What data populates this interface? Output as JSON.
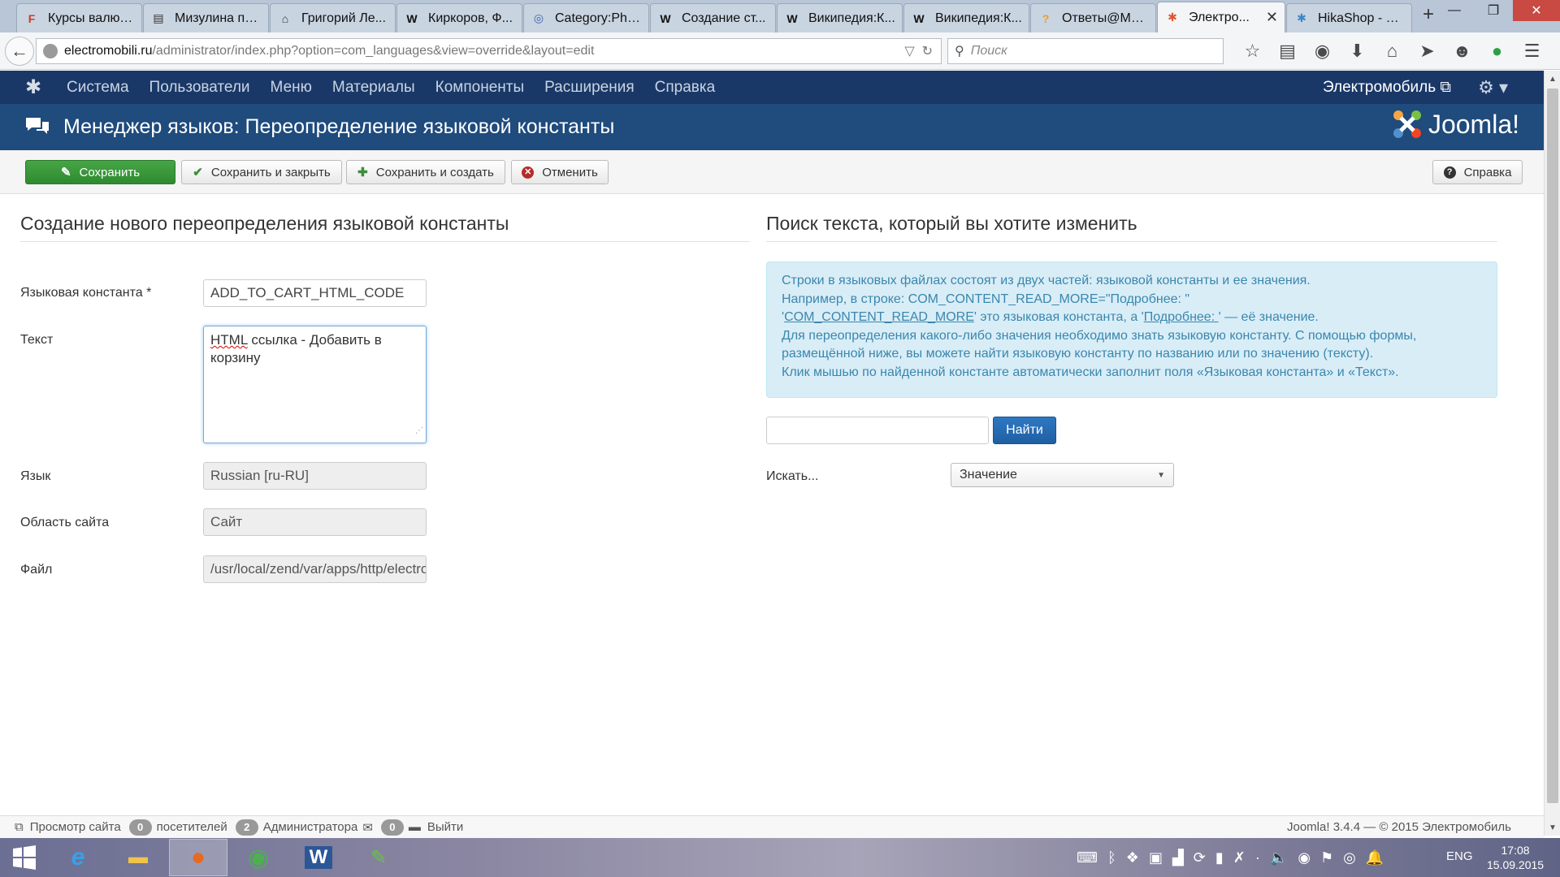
{
  "browser": {
    "tabs": [
      {
        "title": "Курсы валют...",
        "icon": "F",
        "icon_color": "#d0382b"
      },
      {
        "title": "Мизулина пе...",
        "icon": "▤",
        "icon_color": "#333333"
      },
      {
        "title": "Григорий Ле...",
        "icon": "⌂",
        "icon_color": "#333333"
      },
      {
        "title": "Киркоров, Ф...",
        "icon": "W",
        "icon_color": "#111111"
      },
      {
        "title": "Category:Phili...",
        "icon": "◎",
        "icon_color": "#3a64b0"
      },
      {
        "title": "Создание ст...",
        "icon": "W",
        "icon_color": "#111111"
      },
      {
        "title": "Википедия:К...",
        "icon": "W",
        "icon_color": "#111111"
      },
      {
        "title": "Википедия:К...",
        "icon": "W",
        "icon_color": "#111111"
      },
      {
        "title": "Ответы@Mai...",
        "icon": "?",
        "icon_color": "#e8a020"
      },
      {
        "title": "Электро...",
        "icon": "✱",
        "icon_color": "#e0542c",
        "active": true
      },
      {
        "title": "HikaShop - H...",
        "icon": "✱",
        "icon_color": "#3a88c8"
      }
    ],
    "url_host": "electromobili.ru",
    "url_path": "/administrator/index.php?option=com_languages&view=override&layout=edit",
    "search_placeholder": "Поиск"
  },
  "joomla_menu": {
    "items": [
      "Система",
      "Пользователи",
      "Меню",
      "Материалы",
      "Компоненты",
      "Расширения",
      "Справка"
    ],
    "site_name": "Электромобиль"
  },
  "title": "Менеджер языков: Переопределение языковой константы",
  "brand": "Joomla!",
  "toolbar": {
    "save": "Сохранить",
    "save_close": "Сохранить и закрыть",
    "save_new": "Сохранить и создать",
    "cancel": "Отменить",
    "help": "Справка"
  },
  "form": {
    "heading": "Создание нового переопределения языковой константы",
    "constant_label": "Языковая константа *",
    "constant_value": "ADD_TO_CART_HTML_CODE",
    "text_label": "Текст",
    "text_value_word1": "HTML",
    "text_value_rest": " ссылка - Добавить в корзину",
    "language_label": "Язык",
    "language_value": "Russian [ru-RU]",
    "client_label": "Область сайта",
    "client_value": "Сайт",
    "file_label": "Файл",
    "file_value": "/usr/local/zend/var/apps/http/electro"
  },
  "search": {
    "heading": "Поиск текста, который вы хотите изменить",
    "info_line1": "Строки в языковых файлах состоят из двух частей: языковой константы и ее значения.",
    "info_line2": "Например, в строке: COM_CONTENT_READ_MORE=\"Подробнее: \"",
    "info_line3_q1": "'",
    "info_line3_const": "COM_CONTENT_READ_MORE",
    "info_line3_mid": "' это языковая константа, а '",
    "info_line3_value": "Подробнее: ",
    "info_line3_end": "' — её значение.",
    "info_line4": "Для переопределения какого-либо значения необходимо знать языковую константу. С помощью формы, размещённой ниже, вы можете найти языковую константу по названию или по значению (тексту).",
    "info_line5": "Клик мышью по найденной константе автоматически заполнит поля «Языковая константа» и «Текст».",
    "find_button": "Найти",
    "search_in_label": "Искать...",
    "search_in_value": "Значение"
  },
  "status": {
    "view_site": "Просмотр сайта",
    "visitors_count": "0",
    "visitors_label": "посетителей",
    "admins_count": "2",
    "admins_label": "Администратора",
    "messages_count": "0",
    "logout": "Выйти",
    "copyright": "Joomla! 3.4.4  —  © 2015 Электромобиль"
  },
  "taskbar": {
    "lang": "ENG",
    "time": "17:08",
    "date": "15.09.2015"
  }
}
